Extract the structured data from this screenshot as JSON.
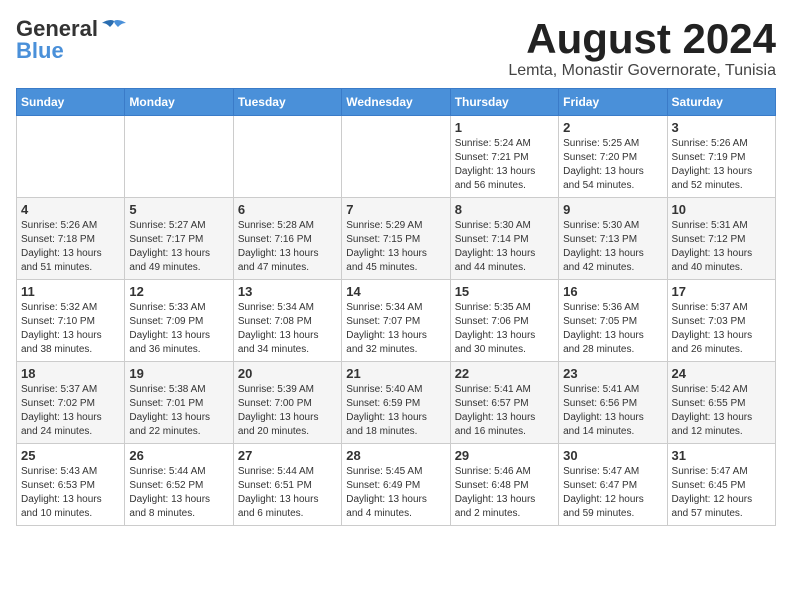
{
  "logo": {
    "general": "General",
    "blue": "Blue"
  },
  "title": "August 2024",
  "subtitle": "Lemta, Monastir Governorate, Tunisia",
  "days_of_week": [
    "Sunday",
    "Monday",
    "Tuesday",
    "Wednesday",
    "Thursday",
    "Friday",
    "Saturday"
  ],
  "weeks": [
    [
      {
        "day": "",
        "info": ""
      },
      {
        "day": "",
        "info": ""
      },
      {
        "day": "",
        "info": ""
      },
      {
        "day": "",
        "info": ""
      },
      {
        "day": "1",
        "info": "Sunrise: 5:24 AM\nSunset: 7:21 PM\nDaylight: 13 hours and 56 minutes."
      },
      {
        "day": "2",
        "info": "Sunrise: 5:25 AM\nSunset: 7:20 PM\nDaylight: 13 hours and 54 minutes."
      },
      {
        "day": "3",
        "info": "Sunrise: 5:26 AM\nSunset: 7:19 PM\nDaylight: 13 hours and 52 minutes."
      }
    ],
    [
      {
        "day": "4",
        "info": "Sunrise: 5:26 AM\nSunset: 7:18 PM\nDaylight: 13 hours and 51 minutes."
      },
      {
        "day": "5",
        "info": "Sunrise: 5:27 AM\nSunset: 7:17 PM\nDaylight: 13 hours and 49 minutes."
      },
      {
        "day": "6",
        "info": "Sunrise: 5:28 AM\nSunset: 7:16 PM\nDaylight: 13 hours and 47 minutes."
      },
      {
        "day": "7",
        "info": "Sunrise: 5:29 AM\nSunset: 7:15 PM\nDaylight: 13 hours and 45 minutes."
      },
      {
        "day": "8",
        "info": "Sunrise: 5:30 AM\nSunset: 7:14 PM\nDaylight: 13 hours and 44 minutes."
      },
      {
        "day": "9",
        "info": "Sunrise: 5:30 AM\nSunset: 7:13 PM\nDaylight: 13 hours and 42 minutes."
      },
      {
        "day": "10",
        "info": "Sunrise: 5:31 AM\nSunset: 7:12 PM\nDaylight: 13 hours and 40 minutes."
      }
    ],
    [
      {
        "day": "11",
        "info": "Sunrise: 5:32 AM\nSunset: 7:10 PM\nDaylight: 13 hours and 38 minutes."
      },
      {
        "day": "12",
        "info": "Sunrise: 5:33 AM\nSunset: 7:09 PM\nDaylight: 13 hours and 36 minutes."
      },
      {
        "day": "13",
        "info": "Sunrise: 5:34 AM\nSunset: 7:08 PM\nDaylight: 13 hours and 34 minutes."
      },
      {
        "day": "14",
        "info": "Sunrise: 5:34 AM\nSunset: 7:07 PM\nDaylight: 13 hours and 32 minutes."
      },
      {
        "day": "15",
        "info": "Sunrise: 5:35 AM\nSunset: 7:06 PM\nDaylight: 13 hours and 30 minutes."
      },
      {
        "day": "16",
        "info": "Sunrise: 5:36 AM\nSunset: 7:05 PM\nDaylight: 13 hours and 28 minutes."
      },
      {
        "day": "17",
        "info": "Sunrise: 5:37 AM\nSunset: 7:03 PM\nDaylight: 13 hours and 26 minutes."
      }
    ],
    [
      {
        "day": "18",
        "info": "Sunrise: 5:37 AM\nSunset: 7:02 PM\nDaylight: 13 hours and 24 minutes."
      },
      {
        "day": "19",
        "info": "Sunrise: 5:38 AM\nSunset: 7:01 PM\nDaylight: 13 hours and 22 minutes."
      },
      {
        "day": "20",
        "info": "Sunrise: 5:39 AM\nSunset: 7:00 PM\nDaylight: 13 hours and 20 minutes."
      },
      {
        "day": "21",
        "info": "Sunrise: 5:40 AM\nSunset: 6:59 PM\nDaylight: 13 hours and 18 minutes."
      },
      {
        "day": "22",
        "info": "Sunrise: 5:41 AM\nSunset: 6:57 PM\nDaylight: 13 hours and 16 minutes."
      },
      {
        "day": "23",
        "info": "Sunrise: 5:41 AM\nSunset: 6:56 PM\nDaylight: 13 hours and 14 minutes."
      },
      {
        "day": "24",
        "info": "Sunrise: 5:42 AM\nSunset: 6:55 PM\nDaylight: 13 hours and 12 minutes."
      }
    ],
    [
      {
        "day": "25",
        "info": "Sunrise: 5:43 AM\nSunset: 6:53 PM\nDaylight: 13 hours and 10 minutes."
      },
      {
        "day": "26",
        "info": "Sunrise: 5:44 AM\nSunset: 6:52 PM\nDaylight: 13 hours and 8 minutes."
      },
      {
        "day": "27",
        "info": "Sunrise: 5:44 AM\nSunset: 6:51 PM\nDaylight: 13 hours and 6 minutes."
      },
      {
        "day": "28",
        "info": "Sunrise: 5:45 AM\nSunset: 6:49 PM\nDaylight: 13 hours and 4 minutes."
      },
      {
        "day": "29",
        "info": "Sunrise: 5:46 AM\nSunset: 6:48 PM\nDaylight: 13 hours and 2 minutes."
      },
      {
        "day": "30",
        "info": "Sunrise: 5:47 AM\nSunset: 6:47 PM\nDaylight: 12 hours and 59 minutes."
      },
      {
        "day": "31",
        "info": "Sunrise: 5:47 AM\nSunset: 6:45 PM\nDaylight: 12 hours and 57 minutes."
      }
    ]
  ]
}
